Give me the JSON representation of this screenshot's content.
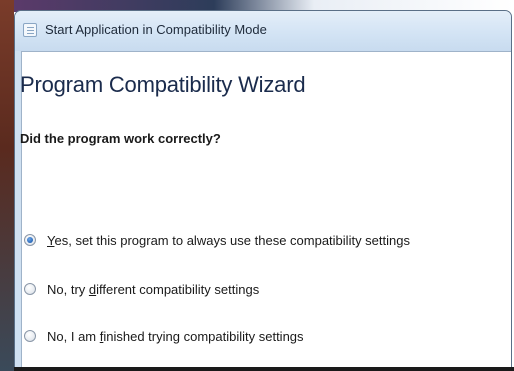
{
  "window": {
    "title": "Start Application in Compatibility Mode"
  },
  "wizard": {
    "heading": "Program Compatibility Wizard",
    "question": "Did the program work correctly?",
    "options": [
      {
        "pre": "",
        "key": "Y",
        "post": "es, set this program to always use these compatibility settings",
        "checked": true
      },
      {
        "pre": "No, try ",
        "key": "d",
        "post": "ifferent compatibility settings",
        "checked": false
      },
      {
        "pre": "No, I am ",
        "key": "f",
        "post": "inished trying compatibility settings",
        "checked": false
      }
    ]
  }
}
